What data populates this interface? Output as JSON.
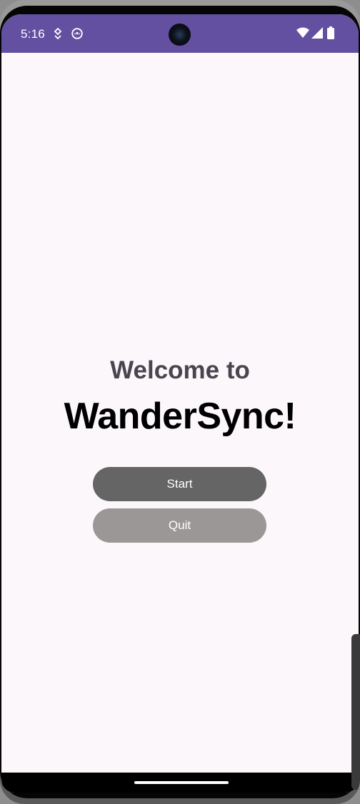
{
  "status_bar": {
    "time": "5:16",
    "background_color": "#6450a1",
    "left_icons": [
      "app-download-icon",
      "android-face-icon"
    ],
    "right_icons": [
      "wifi-icon",
      "cellular-signal-icon",
      "battery-icon"
    ]
  },
  "main": {
    "welcome_text": "Welcome to",
    "app_name": "WanderSync!",
    "start_button_label": "Start",
    "quit_button_label": "Quit",
    "start_button_color": "#656565",
    "quit_button_color": "#9b9797",
    "background_color": "#fcf7fb"
  }
}
